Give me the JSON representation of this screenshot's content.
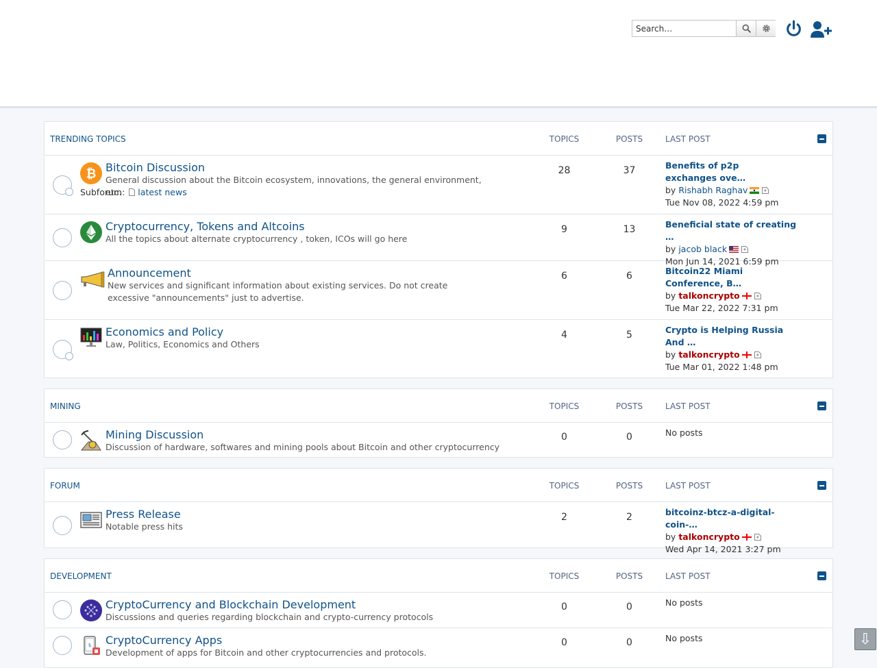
{
  "header": {
    "search_placeholder": "Search…",
    "login_icon": "power-icon",
    "register_icon": "user-plus-icon"
  },
  "columns": {
    "topics": "Topics",
    "posts": "Posts",
    "last_post": "Last post"
  },
  "categories": [
    {
      "title": "Trending Topics",
      "forums": [
        {
          "title": "Bitcoin Discussion",
          "description": "General discussion about the Bitcoin ecosystem, innovations, the general environment, etc.",
          "subforum_label": "Subforum:",
          "subforum": "latest news",
          "topics": "28",
          "posts": "37",
          "last_title": "Benefits of p2p exchanges ove…",
          "by": "by",
          "author": "Rishabh Raghav",
          "date": "Tue Nov 08, 2022 4:59 pm"
        },
        {
          "title": "Cryptocurrency, Tokens and Altcoins",
          "description": "All the topics about alternate cryptocurrency , token, ICOs will go here",
          "topics": "9",
          "posts": "13",
          "last_title": "Beneficial state of creating …",
          "by": "by",
          "author": "jacob black",
          "date": "Mon Jun 14, 2021 6:59 pm"
        },
        {
          "title": "Announcement",
          "description": "New services and significant information about existing services. Do not create excessive \"announcements\" just to advertise.",
          "topics": "6",
          "posts": "6",
          "last_title": "Bitcoin22 Miami Conference, B…",
          "by": "by",
          "author": "talkoncrypto",
          "date": "Tue Mar 22, 2022 7:31 pm"
        },
        {
          "title": "Economics and Policy",
          "description": "Law, Politics, Economics and Others",
          "topics": "4",
          "posts": "5",
          "last_title": "Crypto is Helping Russia And …",
          "by": "by",
          "author": "talkoncrypto",
          "date": "Tue Mar 01, 2022 1:48 pm"
        }
      ]
    },
    {
      "title": "Mining",
      "forums": [
        {
          "title": "Mining Discussion",
          "description": "Discussion of hardware, softwares and mining pools about Bitcoin and other cryptocurrency",
          "topics": "0",
          "posts": "0",
          "no_posts": "No posts"
        }
      ]
    },
    {
      "title": "Forum",
      "forums": [
        {
          "title": "Press Release",
          "description": "Notable press hits",
          "topics": "2",
          "posts": "2",
          "last_title": "bitcoinz-btcz-a-digital-coin-…",
          "by": "by",
          "author": "talkoncrypto",
          "date": "Wed Apr 14, 2021 3:27 pm"
        }
      ]
    },
    {
      "title": "Development",
      "forums": [
        {
          "title": "CryptoCurrency and Blockchain Development",
          "description": "Discussions and queries regarding blockchain and crypto-currency protocols",
          "topics": "0",
          "posts": "0",
          "no_posts": "No posts"
        },
        {
          "title": "CryptoCurrency Apps",
          "description": "Development of apps for Bitcoin and other cryptocurrencies and protocols.",
          "topics": "0",
          "posts": "0",
          "no_posts": "No posts"
        }
      ]
    }
  ],
  "colors": {
    "link": "#105289",
    "admin": "#aa0000",
    "border": "#dee4ea"
  },
  "scroll_icon": "arrow-down-icon",
  "scroll_glyph": "⇩"
}
